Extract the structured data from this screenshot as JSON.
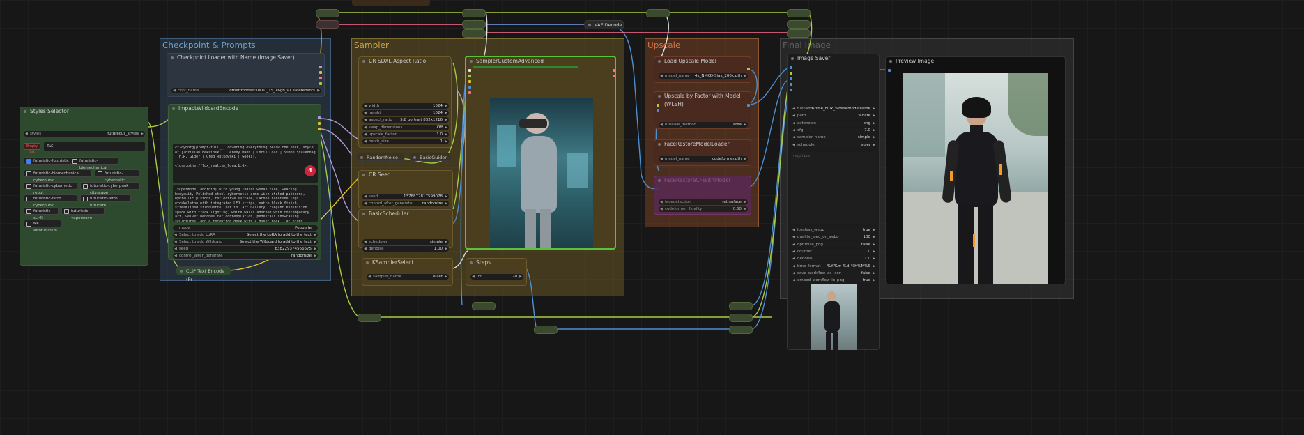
{
  "groups": {
    "checkpoint": {
      "title": "Checkpoint & Prompts"
    },
    "sampler": {
      "title": "Sampler"
    },
    "upscale": {
      "title": "Upscale"
    },
    "final": {
      "title": "Final Image"
    }
  },
  "styles_selector": {
    "title": "Styles Selector",
    "styles_label": "styles",
    "styles_value": "futurecus_styles",
    "empty_label": "Empty list",
    "filter_value": "fut",
    "options": [
      {
        "label": "futuristic-futuristic",
        "checked": true
      },
      {
        "label": "futuristic-biomechanical",
        "checked": false
      },
      {
        "label": "futuristic-biomechanical cyberpunk",
        "checked": false
      },
      {
        "label": "futuristic-cybernetic",
        "checked": false
      },
      {
        "label": "futuristic-cybernetic robot",
        "checked": false
      },
      {
        "label": "futuristic-cyberpunk cityscape",
        "checked": false
      },
      {
        "label": "futuristic-retro cyberpunk",
        "checked": false
      },
      {
        "label": "futuristic-retro futurism",
        "checked": false
      },
      {
        "label": "futuristic-sci-fi",
        "checked": false
      },
      {
        "label": "futuristic-vaporwave",
        "checked": false
      },
      {
        "label": "MK afrofuturism",
        "checked": false
      }
    ]
  },
  "checkpoint_loader": {
    "title": "Checkpoint Loader with Name (Image Saver)",
    "ckpt_label": "ckpt_name",
    "ckpt_value": "other/mode/Flux1D_1S_16gb_v1.safetensors"
  },
  "wildcard": {
    "title": "ImpactWildcardEncode",
    "text1": "<f-cyborg|prompt-full__, covering everything below the neck, style of [Zdzislaw Beksinski | Jeremy Mann | Chris Cold | Simon Stalenhag | H.R. Giger | Greg Rutkowski | Goeki],\n\n<lora:other/flux_realism_lora:1.0>,",
    "badge": "4",
    "text2": "(supermodel android) with young indian woman face, wearing bodysuit, Polished steel cybernetic arms with etched patterns, hydraulic pistons, reflective surface, Carbon nanotube legs exoskeleton with integrated LED strips, matte black finish, streamlined silhouette, sat in  Art Gallery, Elegant exhibition space with track lighting, white walls adorned with contemporary art, velvet benches for contemplation, pedestals showcasing sculptures, and a reception desk with a guest book , at night. covering everything below the neck, style of Jeremy Mann .",
    "mode_label": "mode",
    "mode_value": "Populate",
    "lora_label": "Select to add LoRA",
    "lora_value": "Select the LoRA to add to the text",
    "wild_label": "Select to add Wildcard",
    "wild_value": "Select the Wildcard to add to the text",
    "seed_label": "seed",
    "seed_value": "838229374566675",
    "cag_label": "control_after_generate",
    "cag_value": "randomize"
  },
  "clip_text": {
    "title": "CLIP Text Encode (Pr"
  },
  "aspect": {
    "title": "CR SDXL Aspect Ratio",
    "rows": [
      [
        "width",
        "1024"
      ],
      [
        "height",
        "1024"
      ],
      [
        "aspect_ratio",
        "5:8 portrait 832x1216"
      ],
      [
        "swap_dimensions",
        "Off"
      ],
      [
        "upscale_factor",
        "1.0"
      ],
      [
        "batch_size",
        "1"
      ]
    ]
  },
  "random_noise": {
    "title": "RandomNoise"
  },
  "basic_guider": {
    "title": "BasicGuider"
  },
  "cr_seed": {
    "title": "CR Seed",
    "seed_label": "seed",
    "seed_value": "1378872817599078",
    "cag_label": "control_after_generate",
    "cag_value": "randomize"
  },
  "scheduler": {
    "title": "BasicScheduler",
    "rows": [
      [
        "scheduler",
        "simple"
      ],
      [
        "denoise",
        "1.00"
      ]
    ]
  },
  "ksampler": {
    "title": "KSamplerSelect",
    "sampler_label": "sampler_name",
    "sampler_value": "euler"
  },
  "steps": {
    "title": "Steps",
    "label": "int",
    "value": "20"
  },
  "sca": {
    "title": "SamplerCustomAdvanced"
  },
  "vae": {
    "title": "VAE Decode"
  },
  "upscale_load": {
    "title": "Load Upscale Model",
    "label": "model_name",
    "value": "4x_NMKD-Siax_200k.pth"
  },
  "upscale_factor": {
    "title": "Upscale by Factor with Model (WLSH)",
    "label": "upscale_method",
    "value": "area"
  },
  "face_loader": {
    "title": "FaceRestoreModelLoader",
    "label": "model_name",
    "value": "codeformer.pth"
  },
  "face_restore": {
    "title": "FaceRestoreCFWithModel",
    "rows": [
      [
        "facedetection",
        "retinaface"
      ],
      [
        "codeformer_fidelity",
        "0.50"
      ]
    ]
  },
  "image_saver": {
    "title": "Image Saver",
    "rows": [
      [
        "filename",
        "%time_Flux_%basemodelname"
      ],
      [
        "path",
        "%date"
      ],
      [
        "extension",
        "png"
      ],
      [
        "cfg",
        "7.0"
      ],
      [
        "sampler_name",
        "simple"
      ],
      [
        "scheduler",
        "euler"
      ]
    ],
    "negative_placeholder": "negative",
    "rows2": [
      [
        "lossless_webp",
        "true"
      ],
      [
        "quality_jpeg_or_webp",
        "100"
      ],
      [
        "optimize_png",
        "false"
      ],
      [
        "counter",
        "0"
      ],
      [
        "denoise",
        "1.0"
      ],
      [
        "time_format",
        "%Y-%m-%d_%H%M%S"
      ],
      [
        "save_workflow_as_json",
        "false"
      ],
      [
        "embed_workflow_in_png",
        "true"
      ]
    ]
  },
  "preview": {
    "title": "Preview Image"
  }
}
